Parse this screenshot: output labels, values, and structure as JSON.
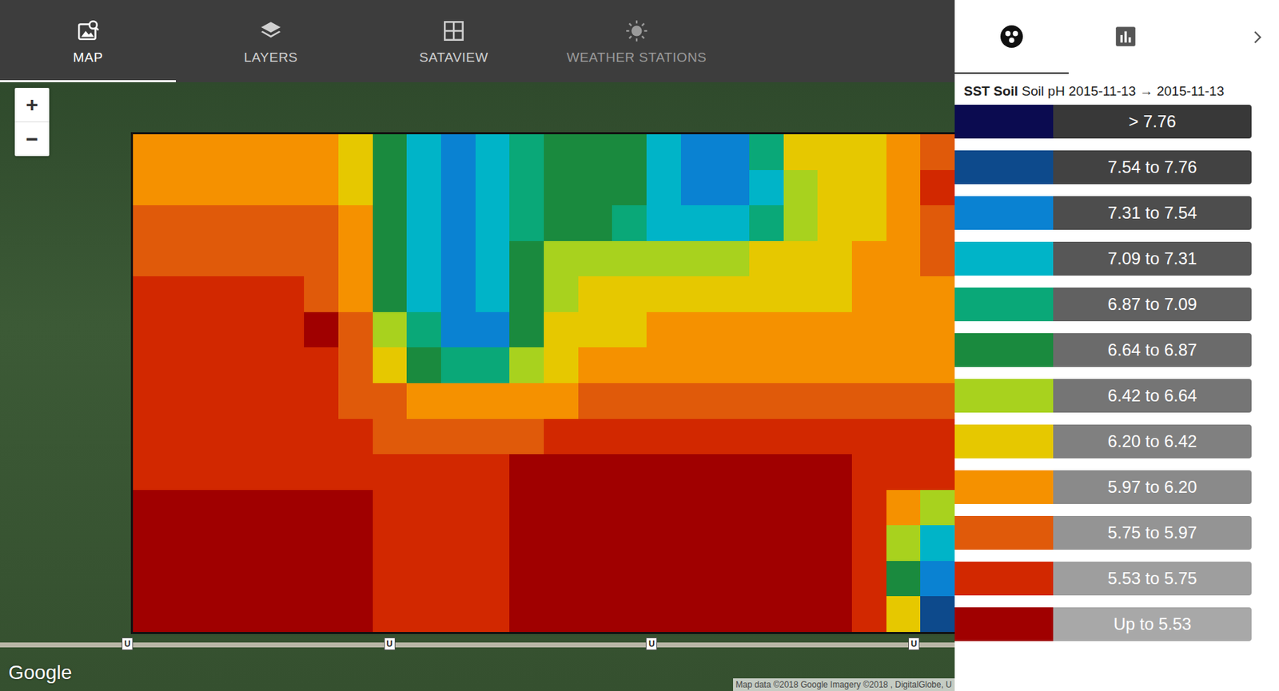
{
  "tabs": [
    {
      "label": "MAP",
      "selected": true,
      "disabled": false
    },
    {
      "label": "LAYERS",
      "selected": false,
      "disabled": false
    },
    {
      "label": "SATAVIEW",
      "selected": false,
      "disabled": false
    },
    {
      "label": "WEATHER STATIONS",
      "selected": false,
      "disabled": true
    }
  ],
  "zoom": {
    "in": "+",
    "out": "−"
  },
  "map": {
    "logo": "Google",
    "attribution": "Map data ©2018 Google Imagery ©2018 , DigitalGlobe, U",
    "pins": [
      {
        "label": "U"
      },
      {
        "label": "U"
      },
      {
        "label": "U"
      },
      {
        "label": "U"
      }
    ]
  },
  "panel": {
    "tabs": [
      {
        "selected": true
      },
      {
        "selected": false
      }
    ],
    "title": {
      "source": "SST Soil",
      "layer": "Soil pH 2015-11-13 → 2015-11-13"
    }
  },
  "legend": [
    {
      "label": "> 7.76",
      "color": "#0b0b50"
    },
    {
      "label": "7.54 to 7.76",
      "color": "#0d4a8c"
    },
    {
      "label": "7.31 to 7.54",
      "color": "#0a82d2"
    },
    {
      "label": "7.09 to 7.31",
      "color": "#00b4c8"
    },
    {
      "label": "6.87 to 7.09",
      "color": "#0aa878"
    },
    {
      "label": "6.64 to 6.87",
      "color": "#1a8a3e"
    },
    {
      "label": "6.42 to 6.64",
      "color": "#a8d21e"
    },
    {
      "label": "6.20 to 6.42",
      "color": "#e6c800"
    },
    {
      "label": "5.97 to 6.20",
      "color": "#f59100"
    },
    {
      "label": "5.75 to 5.97",
      "color": "#e05a0a"
    },
    {
      "label": "5.53 to 5.75",
      "color": "#d22800"
    },
    {
      "label": "Up to 5.53",
      "color": "#a00000"
    }
  ],
  "field": {
    "grid": [
      [
        8,
        8,
        8,
        8,
        8,
        8,
        7,
        5,
        3,
        2,
        3,
        4,
        5,
        5,
        5,
        3,
        2,
        2,
        4,
        7,
        7,
        7,
        8,
        9
      ],
      [
        8,
        8,
        8,
        8,
        8,
        8,
        7,
        5,
        3,
        2,
        3,
        4,
        5,
        5,
        5,
        3,
        2,
        2,
        3,
        6,
        7,
        7,
        8,
        10
      ],
      [
        9,
        9,
        9,
        9,
        9,
        9,
        8,
        5,
        3,
        2,
        3,
        4,
        5,
        5,
        4,
        3,
        3,
        3,
        4,
        6,
        7,
        7,
        8,
        9
      ],
      [
        9,
        9,
        9,
        9,
        9,
        9,
        8,
        5,
        3,
        2,
        3,
        5,
        6,
        6,
        6,
        6,
        6,
        6,
        7,
        7,
        7,
        8,
        8,
        9
      ],
      [
        10,
        10,
        10,
        10,
        10,
        9,
        8,
        5,
        3,
        2,
        3,
        5,
        6,
        7,
        7,
        7,
        7,
        7,
        7,
        7,
        7,
        8,
        8,
        8
      ],
      [
        10,
        10,
        10,
        10,
        10,
        11,
        9,
        6,
        4,
        2,
        2,
        5,
        7,
        7,
        7,
        8,
        8,
        8,
        8,
        8,
        8,
        8,
        8,
        8
      ],
      [
        10,
        10,
        10,
        10,
        10,
        10,
        9,
        7,
        5,
        4,
        4,
        6,
        7,
        8,
        8,
        8,
        8,
        8,
        8,
        8,
        8,
        8,
        8,
        8
      ],
      [
        10,
        10,
        10,
        10,
        10,
        10,
        9,
        9,
        8,
        8,
        8,
        8,
        8,
        9,
        9,
        9,
        9,
        9,
        9,
        9,
        9,
        9,
        9,
        9
      ],
      [
        10,
        10,
        10,
        10,
        10,
        10,
        10,
        9,
        9,
        9,
        9,
        9,
        10,
        10,
        10,
        10,
        10,
        10,
        10,
        10,
        10,
        10,
        10,
        10
      ],
      [
        10,
        10,
        10,
        10,
        10,
        10,
        10,
        10,
        10,
        10,
        10,
        11,
        11,
        11,
        11,
        11,
        11,
        11,
        11,
        11,
        11,
        10,
        10,
        10
      ],
      [
        11,
        11,
        11,
        11,
        11,
        11,
        11,
        10,
        10,
        10,
        10,
        11,
        11,
        11,
        11,
        11,
        11,
        11,
        11,
        11,
        11,
        10,
        8,
        6
      ],
      [
        11,
        11,
        11,
        11,
        11,
        11,
        11,
        10,
        10,
        10,
        10,
        11,
        11,
        11,
        11,
        11,
        11,
        11,
        11,
        11,
        11,
        10,
        6,
        3
      ],
      [
        11,
        11,
        11,
        11,
        11,
        11,
        11,
        10,
        10,
        10,
        10,
        11,
        11,
        11,
        11,
        11,
        11,
        11,
        11,
        11,
        11,
        10,
        5,
        2
      ],
      [
        11,
        11,
        11,
        11,
        11,
        11,
        11,
        10,
        10,
        10,
        10,
        11,
        11,
        11,
        11,
        11,
        11,
        11,
        11,
        11,
        11,
        10,
        7,
        1
      ]
    ]
  }
}
